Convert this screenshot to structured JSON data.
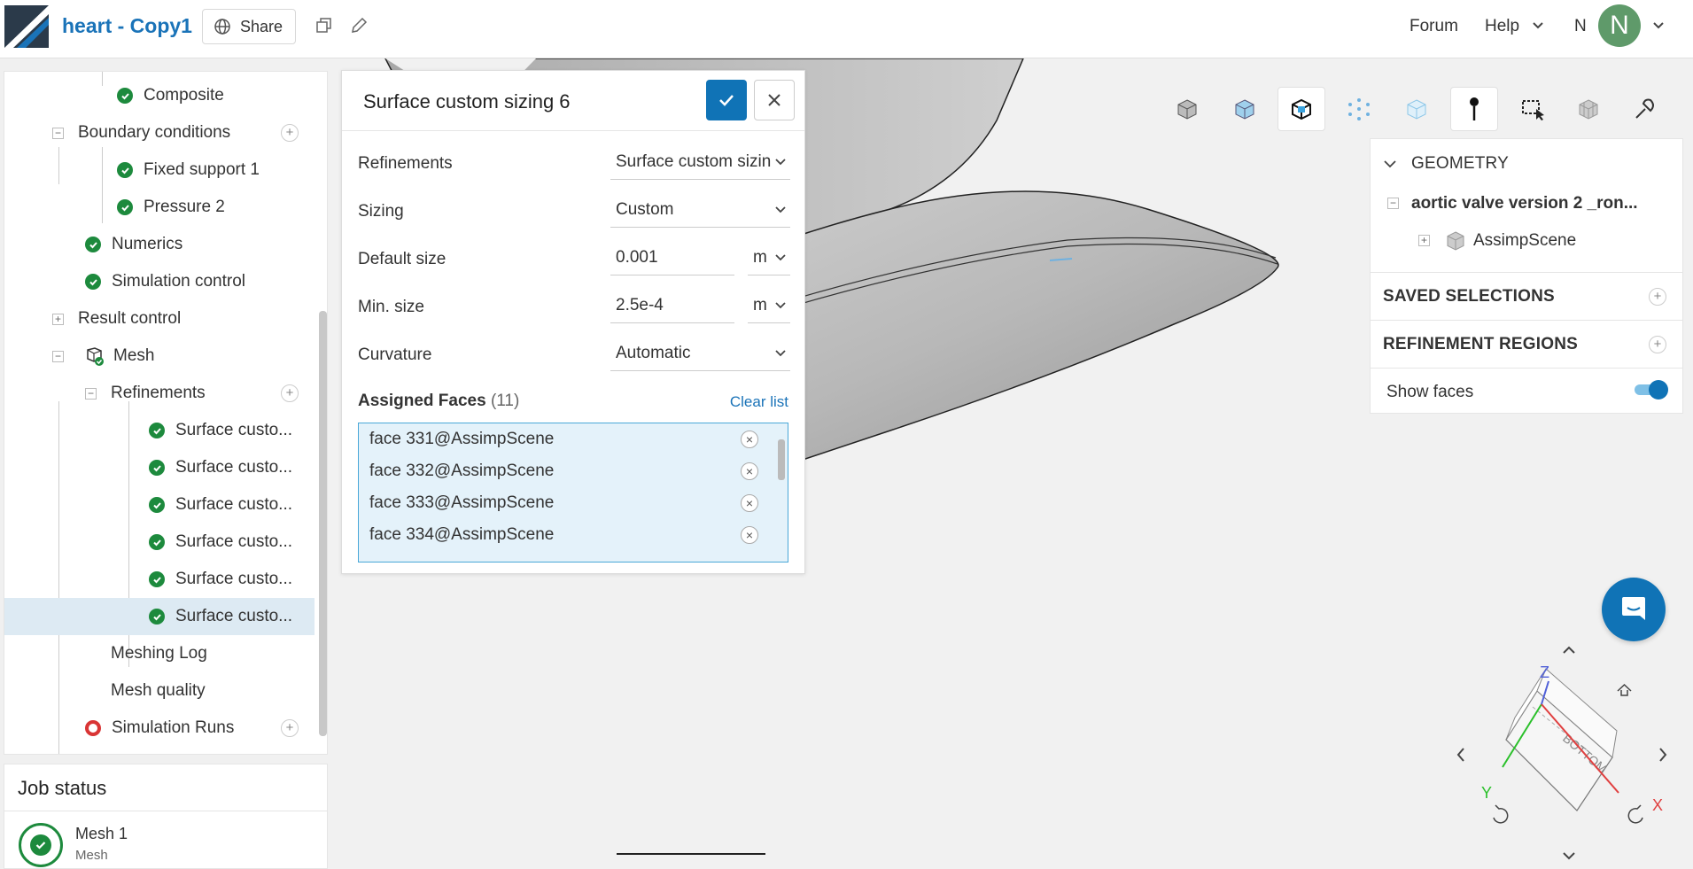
{
  "header": {
    "title": "heart - Copy1",
    "share_label": "Share",
    "forum_label": "Forum",
    "help_label": "Help",
    "user_initial": "N",
    "avatar_letter": "N"
  },
  "tree": {
    "items": [
      {
        "label": "Composite",
        "status": "ok"
      },
      {
        "label": "Boundary conditions",
        "status": "none"
      },
      {
        "label": "Fixed support 1",
        "status": "ok"
      },
      {
        "label": "Pressure 2",
        "status": "ok"
      },
      {
        "label": "Numerics",
        "status": "ok"
      },
      {
        "label": "Simulation control",
        "status": "ok"
      },
      {
        "label": "Result control",
        "status": "none"
      },
      {
        "label": "Mesh",
        "status": "mesh"
      },
      {
        "label": "Refinements",
        "status": "none"
      },
      {
        "label": "Surface custo...",
        "status": "ok"
      },
      {
        "label": "Surface custo...",
        "status": "ok"
      },
      {
        "label": "Surface custo...",
        "status": "ok"
      },
      {
        "label": "Surface custo...",
        "status": "ok"
      },
      {
        "label": "Surface custo...",
        "status": "ok"
      },
      {
        "label": "Surface custo...",
        "status": "ok",
        "selected": true
      },
      {
        "label": "Meshing Log",
        "status": "none"
      },
      {
        "label": "Mesh quality",
        "status": "none"
      },
      {
        "label": "Simulation Runs",
        "status": "error"
      }
    ]
  },
  "job_status": {
    "title": "Job status",
    "job_name": "Mesh 1",
    "job_type": "Mesh"
  },
  "dialog": {
    "title": "Surface custom sizing 6",
    "refinements_label": "Refinements",
    "refinements_value": "Surface custom sizin",
    "sizing_label": "Sizing",
    "sizing_value": "Custom",
    "default_size_label": "Default size",
    "default_size_value": "0.001",
    "default_size_unit": "m",
    "min_size_label": "Min. size",
    "min_size_value": "2.5e-4",
    "min_size_unit": "m",
    "curvature_label": "Curvature",
    "curvature_value": "Automatic",
    "assigned_faces_label": "Assigned Faces",
    "assigned_faces_count": "(11)",
    "clear_list_label": "Clear list",
    "faces": [
      "face 331@AssimpScene",
      "face 332@AssimpScene",
      "face 333@AssimpScene",
      "face 334@AssimpScene"
    ]
  },
  "right_panel": {
    "geometry_label": "GEOMETRY",
    "geometry_item": "aortic valve version 2 _ron...",
    "scene_item": "AssimpScene",
    "saved_selections_label": "SAVED SELECTIONS",
    "refinement_regions_label": "REFINEMENT REGIONS",
    "show_faces_label": "Show faces",
    "show_faces_on": true
  },
  "orientation_cube": {
    "face_label": "BOTTOM",
    "axis_x": "X",
    "axis_y": "Y",
    "axis_z": "Z"
  },
  "colors": {
    "accent": "#1073b6",
    "success": "#1d8a3d",
    "error": "#d93535",
    "selection_bg": "#ddeaf3"
  }
}
